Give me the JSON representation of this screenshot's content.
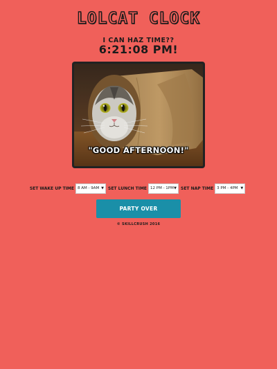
{
  "header": {
    "title": "LOLCAT CLOCK",
    "subtitle": "I CAN HAZ TIME??",
    "time": "6:21:08 PM!"
  },
  "photo": {
    "caption": "\"GOOD AFTERNOON!\""
  },
  "controls": {
    "wakeup": {
      "label": "SET WAKE UP TIME",
      "selected": "8 AM - 9AM"
    },
    "lunch": {
      "label": "SET LUNCH TIME",
      "selected": "12 PM - 1PM"
    },
    "nap": {
      "label": "SET NAP TIME",
      "selected": "3 PM - 4PM"
    }
  },
  "party_button": {
    "label": "PARTY OVER"
  },
  "footer": {
    "copyright": "© SKILLCRUSH 2016"
  },
  "colors": {
    "background": "#f0605a",
    "button": "#1a8fa8",
    "text": "#1b1b1b"
  }
}
